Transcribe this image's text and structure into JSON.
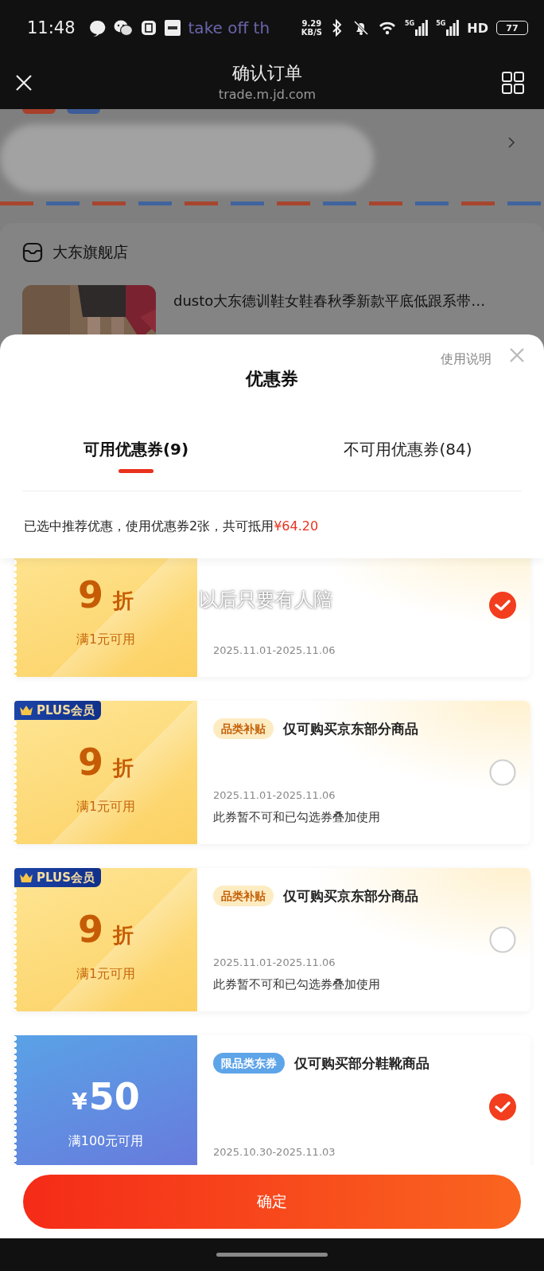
{
  "status_bar": {
    "time": "11:48",
    "lyric": "take off th",
    "net_speed": "9.29",
    "net_unit": "KB/S",
    "signals": [
      "5G",
      "5G"
    ],
    "hd": "HD",
    "battery": "77"
  },
  "nav_bar": {
    "title": "确认订单",
    "url": "trade.m.jd.com"
  },
  "order_page": {
    "store_name": "大东旗舰店",
    "product_title": "dusto大东德训鞋女鞋春秋季新款平底低跟系带…"
  },
  "coupon_sheet": {
    "title": "优惠券",
    "help_link": "使用说明",
    "tabs": [
      {
        "label": "可用优惠券(9)",
        "selected": true
      },
      {
        "label": "不可用优惠券(84)",
        "selected": false
      }
    ],
    "summary": "已选中推荐优惠，使用优惠券2张，共可抵用",
    "summary_amount": "¥64.20",
    "coupons": [
      {
        "kind": "discount",
        "value": "9",
        "unit": "折",
        "condition": "满1元可用",
        "date": "2025.11.01-2025.11.06",
        "selected": true
      },
      {
        "kind": "discount",
        "badge": "PLUS会员",
        "value": "9",
        "unit": "折",
        "condition": "满1元可用",
        "tag": "品类补贴",
        "title": "仅可购买京东部分商品",
        "date": "2025.11.01-2025.11.06",
        "note": "此券暂不可和已勾选券叠加使用",
        "selected": false
      },
      {
        "kind": "discount",
        "badge": "PLUS会员",
        "value": "9",
        "unit": "折",
        "condition": "满1元可用",
        "tag": "品类补贴",
        "title": "仅可购买京东部分商品",
        "date": "2025.11.01-2025.11.06",
        "note": "此券暂不可和已勾选券叠加使用",
        "selected": false
      },
      {
        "kind": "cash",
        "prefix": "¥",
        "value": "50",
        "condition": "满100元可用",
        "tag": "限品类东券",
        "title": "仅可购买部分鞋靴商品",
        "date": "2025.10.30-2025.11.03",
        "selected": true
      }
    ],
    "lyric_overlay": "以后只要有人陪",
    "confirm_button": "确定"
  }
}
